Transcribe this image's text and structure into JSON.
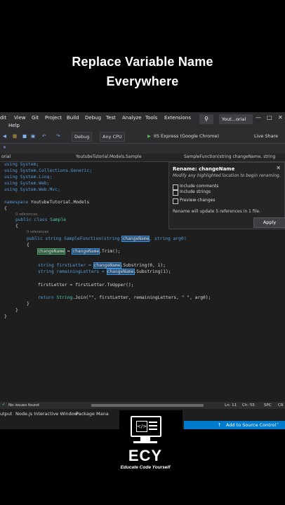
{
  "video_title": {
    "line1": "Replace Variable Name",
    "line2": "Everywhere"
  },
  "menubar": {
    "items": [
      "dit",
      "View",
      "Git",
      "Project",
      "Build",
      "Debug",
      "Test",
      "Analyze",
      "Tools",
      "Extensions"
    ],
    "help": "Help",
    "solution": "Yout...orial"
  },
  "toolbar": {
    "config": "Debug",
    "platform": "Any CPU",
    "run_target": "IIS Express (Google Chrome)",
    "live_share": "Live Share"
  },
  "navbar": {
    "project": "orial",
    "class": "YoutubeTutorial.Models.Sample",
    "member": "SampleFunction(string changeName, string"
  },
  "code": {
    "usings": [
      "using System;",
      "using System.Collections.Generic;",
      "using System.Linq;",
      "using System.Web;",
      "using System.Web.Mvc;"
    ],
    "namespace_kw": "namespace",
    "namespace_name": "YoutubeTutorial.Models",
    "refs0": "0 references",
    "class_decl_kw": "public class",
    "class_name": "Sample",
    "refs1": "0 references",
    "method_prefix": "public string SampleFunction(string ",
    "param_name": "changeName",
    "method_suffix": ", string arg0)",
    "line_trim_a": "changeName",
    "line_trim_mid": " = ",
    "line_trim_b": "changeName",
    "line_trim_end": ".Trim();",
    "first_decl": "string firstLetter = ",
    "first_var": "changeName",
    "first_end": ".Substring(0, 1);",
    "rem_decl": "string remainingLetters = ",
    "rem_var": "changeName",
    "rem_end": ".Substring(1);",
    "upper_line": "firstLetter = firstLetter.ToUpper();",
    "return_kw": "return",
    "return_type": "String",
    "return_rest": ".Join(\"\", firstLetter, remainingLetters, \" \", arg0);"
  },
  "rename_panel": {
    "title": "Rename: changeName",
    "subtitle": "Modify any highlighted location to begin renaming.",
    "options": [
      "Include comments",
      "Include strings",
      "Preview changes"
    ],
    "info": "Rename will update 5 references in 1 file.",
    "apply": "Apply"
  },
  "status": {
    "issues": "No issues found",
    "line": "Ln: 11",
    "col": "Ch: 55",
    "mode1": "SPC",
    "mode2": "CR"
  },
  "bottom_tabs": [
    "utput",
    "Node.js Interactive Window",
    "Package Mana"
  ],
  "source_control": "Add to Source Control",
  "logo": {
    "name": "ECY",
    "tagline": "Educate Code Yourself"
  },
  "colors": {
    "accent": "#007acc",
    "keyword": "#569cd6",
    "type": "#4ec9b0",
    "string": "#d69d85"
  }
}
